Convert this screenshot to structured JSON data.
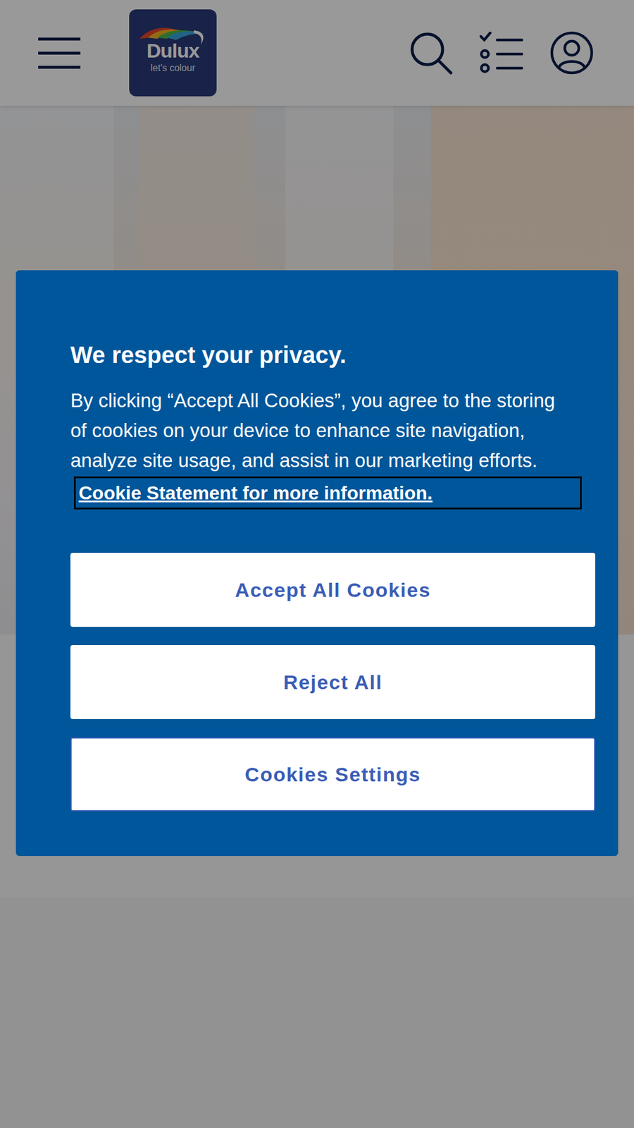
{
  "header": {
    "logo": {
      "brand": "Dulux",
      "tagline": "let's colour"
    }
  },
  "cookie_banner": {
    "title": "We respect your privacy.",
    "body": "By clicking “Accept All Cookies”, you agree to the storing of cookies on your device to enhance site navigation, analyze site usage, and assist in our marketing efforts.",
    "link": {
      "label": "Cookie Statement for more information.",
      "focused": true
    },
    "buttons": [
      {
        "label": "Accept All Cookies",
        "highlighted": false
      },
      {
        "label": "Reject All",
        "highlighted": false
      },
      {
        "label": "Cookies Settings",
        "highlighted": true
      }
    ]
  }
}
